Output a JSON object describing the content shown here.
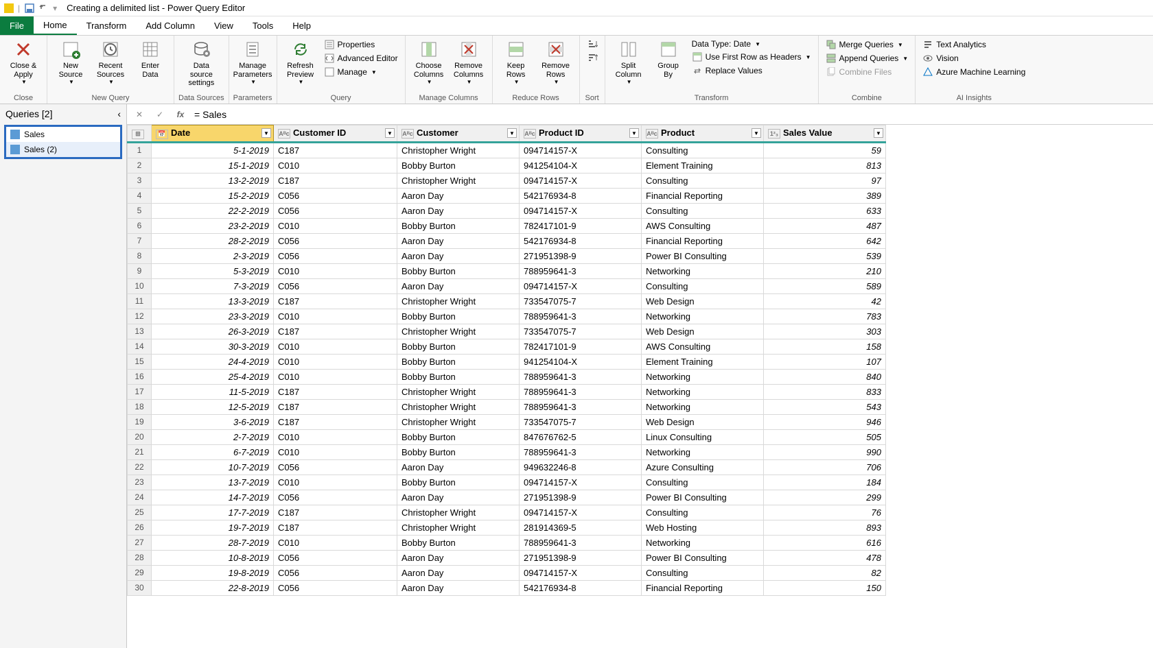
{
  "titlebar": {
    "title": "Creating a delimited list - Power Query Editor"
  },
  "menu": {
    "file": "File",
    "tabs": [
      "Home",
      "Transform",
      "Add Column",
      "View",
      "Tools",
      "Help"
    ],
    "active": "Home"
  },
  "ribbon": {
    "close": {
      "closeapply": "Close &\nApply",
      "group": "Close"
    },
    "newquery": {
      "newsource": "New\nSource",
      "recent": "Recent\nSources",
      "enter": "Enter\nData",
      "group": "New Query"
    },
    "datasources": {
      "settings": "Data source\nsettings",
      "group": "Data Sources"
    },
    "parameters": {
      "manage": "Manage\nParameters",
      "group": "Parameters"
    },
    "query": {
      "refresh": "Refresh\nPreview",
      "properties": "Properties",
      "advanced": "Advanced Editor",
      "managebtn": "Manage",
      "group": "Query"
    },
    "managecols": {
      "choose": "Choose\nColumns",
      "remove": "Remove\nColumns",
      "group": "Manage Columns"
    },
    "reducerows": {
      "keep": "Keep\nRows",
      "remove": "Remove\nRows",
      "group": "Reduce Rows"
    },
    "sort": {
      "group": "Sort"
    },
    "transform": {
      "split": "Split\nColumn",
      "groupby": "Group\nBy",
      "datatype": "Data Type: Date",
      "firstrow": "Use First Row as Headers",
      "replace": "Replace Values",
      "group": "Transform"
    },
    "combine": {
      "merge": "Merge Queries",
      "append": "Append Queries",
      "combinefiles": "Combine Files",
      "group": "Combine"
    },
    "ai": {
      "textanalytics": "Text Analytics",
      "vision": "Vision",
      "azureml": "Azure Machine Learning",
      "group": "AI Insights"
    }
  },
  "sidebar": {
    "title": "Queries [2]",
    "items": [
      {
        "label": "Sales"
      },
      {
        "label": "Sales (2)"
      }
    ]
  },
  "formula": {
    "text": "= Sales"
  },
  "columns": [
    {
      "key": "date",
      "label": "Date",
      "type": "date"
    },
    {
      "key": "custid",
      "label": "Customer ID",
      "type": "text"
    },
    {
      "key": "customer",
      "label": "Customer",
      "type": "text"
    },
    {
      "key": "prodid",
      "label": "Product ID",
      "type": "text"
    },
    {
      "key": "product",
      "label": "Product",
      "type": "text"
    },
    {
      "key": "sales",
      "label": "Sales Value",
      "type": "num"
    }
  ],
  "rows": [
    {
      "date": "5-1-2019",
      "custid": "C187",
      "customer": "Christopher Wright",
      "prodid": "094714157-X",
      "product": "Consulting",
      "sales": "59"
    },
    {
      "date": "15-1-2019",
      "custid": "C010",
      "customer": "Bobby Burton",
      "prodid": "941254104-X",
      "product": "Element Training",
      "sales": "813"
    },
    {
      "date": "13-2-2019",
      "custid": "C187",
      "customer": "Christopher Wright",
      "prodid": "094714157-X",
      "product": "Consulting",
      "sales": "97"
    },
    {
      "date": "15-2-2019",
      "custid": "C056",
      "customer": "Aaron Day",
      "prodid": "542176934-8",
      "product": "Financial Reporting",
      "sales": "389"
    },
    {
      "date": "22-2-2019",
      "custid": "C056",
      "customer": "Aaron Day",
      "prodid": "094714157-X",
      "product": "Consulting",
      "sales": "633"
    },
    {
      "date": "23-2-2019",
      "custid": "C010",
      "customer": "Bobby Burton",
      "prodid": "782417101-9",
      "product": "AWS Consulting",
      "sales": "487"
    },
    {
      "date": "28-2-2019",
      "custid": "C056",
      "customer": "Aaron Day",
      "prodid": "542176934-8",
      "product": "Financial Reporting",
      "sales": "642"
    },
    {
      "date": "2-3-2019",
      "custid": "C056",
      "customer": "Aaron Day",
      "prodid": "271951398-9",
      "product": "Power BI Consulting",
      "sales": "539"
    },
    {
      "date": "5-3-2019",
      "custid": "C010",
      "customer": "Bobby Burton",
      "prodid": "788959641-3",
      "product": "Networking",
      "sales": "210"
    },
    {
      "date": "7-3-2019",
      "custid": "C056",
      "customer": "Aaron Day",
      "prodid": "094714157-X",
      "product": "Consulting",
      "sales": "589"
    },
    {
      "date": "13-3-2019",
      "custid": "C187",
      "customer": "Christopher Wright",
      "prodid": "733547075-7",
      "product": "Web Design",
      "sales": "42"
    },
    {
      "date": "23-3-2019",
      "custid": "C010",
      "customer": "Bobby Burton",
      "prodid": "788959641-3",
      "product": "Networking",
      "sales": "783"
    },
    {
      "date": "26-3-2019",
      "custid": "C187",
      "customer": "Christopher Wright",
      "prodid": "733547075-7",
      "product": "Web Design",
      "sales": "303"
    },
    {
      "date": "30-3-2019",
      "custid": "C010",
      "customer": "Bobby Burton",
      "prodid": "782417101-9",
      "product": "AWS Consulting",
      "sales": "158"
    },
    {
      "date": "24-4-2019",
      "custid": "C010",
      "customer": "Bobby Burton",
      "prodid": "941254104-X",
      "product": "Element Training",
      "sales": "107"
    },
    {
      "date": "25-4-2019",
      "custid": "C010",
      "customer": "Bobby Burton",
      "prodid": "788959641-3",
      "product": "Networking",
      "sales": "840"
    },
    {
      "date": "11-5-2019",
      "custid": "C187",
      "customer": "Christopher Wright",
      "prodid": "788959641-3",
      "product": "Networking",
      "sales": "833"
    },
    {
      "date": "12-5-2019",
      "custid": "C187",
      "customer": "Christopher Wright",
      "prodid": "788959641-3",
      "product": "Networking",
      "sales": "543"
    },
    {
      "date": "3-6-2019",
      "custid": "C187",
      "customer": "Christopher Wright",
      "prodid": "733547075-7",
      "product": "Web Design",
      "sales": "946"
    },
    {
      "date": "2-7-2019",
      "custid": "C010",
      "customer": "Bobby Burton",
      "prodid": "847676762-5",
      "product": "Linux Consulting",
      "sales": "505"
    },
    {
      "date": "6-7-2019",
      "custid": "C010",
      "customer": "Bobby Burton",
      "prodid": "788959641-3",
      "product": "Networking",
      "sales": "990"
    },
    {
      "date": "10-7-2019",
      "custid": "C056",
      "customer": "Aaron Day",
      "prodid": "949632246-8",
      "product": "Azure Consulting",
      "sales": "706"
    },
    {
      "date": "13-7-2019",
      "custid": "C010",
      "customer": "Bobby Burton",
      "prodid": "094714157-X",
      "product": "Consulting",
      "sales": "184"
    },
    {
      "date": "14-7-2019",
      "custid": "C056",
      "customer": "Aaron Day",
      "prodid": "271951398-9",
      "product": "Power BI Consulting",
      "sales": "299"
    },
    {
      "date": "17-7-2019",
      "custid": "C187",
      "customer": "Christopher Wright",
      "prodid": "094714157-X",
      "product": "Consulting",
      "sales": "76"
    },
    {
      "date": "19-7-2019",
      "custid": "C187",
      "customer": "Christopher Wright",
      "prodid": "281914369-5",
      "product": "Web Hosting",
      "sales": "893"
    },
    {
      "date": "28-7-2019",
      "custid": "C010",
      "customer": "Bobby Burton",
      "prodid": "788959641-3",
      "product": "Networking",
      "sales": "616"
    },
    {
      "date": "10-8-2019",
      "custid": "C056",
      "customer": "Aaron Day",
      "prodid": "271951398-9",
      "product": "Power BI Consulting",
      "sales": "478"
    },
    {
      "date": "19-8-2019",
      "custid": "C056",
      "customer": "Aaron Day",
      "prodid": "094714157-X",
      "product": "Consulting",
      "sales": "82"
    },
    {
      "date": "22-8-2019",
      "custid": "C056",
      "customer": "Aaron Day",
      "prodid": "542176934-8",
      "product": "Financial Reporting",
      "sales": "150"
    }
  ]
}
